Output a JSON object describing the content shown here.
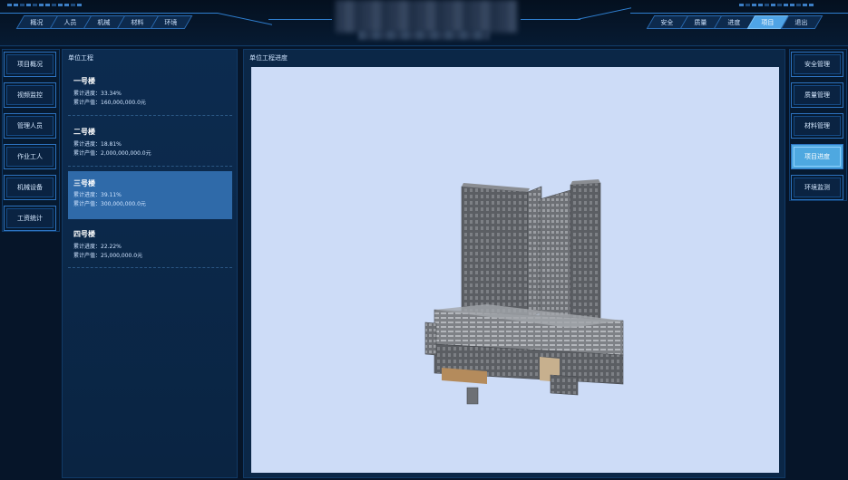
{
  "header": {
    "left_tabs": [
      {
        "label": "概况"
      },
      {
        "label": "人员"
      },
      {
        "label": "机械"
      },
      {
        "label": "材料"
      },
      {
        "label": "环境"
      }
    ],
    "right_tabs": [
      {
        "label": "安全"
      },
      {
        "label": "质量"
      },
      {
        "label": "进度"
      },
      {
        "label": "项目",
        "active": true
      },
      {
        "label": "退出"
      }
    ]
  },
  "left_menu": {
    "items": [
      {
        "label": "项目概况"
      },
      {
        "label": "视频监控"
      },
      {
        "label": "管理人员"
      },
      {
        "label": "作业工人"
      },
      {
        "label": "机械设备"
      },
      {
        "label": "工资统计"
      }
    ]
  },
  "right_menu": {
    "items": [
      {
        "label": "安全管理"
      },
      {
        "label": "质量管理"
      },
      {
        "label": "材料管理"
      },
      {
        "label": "项目进度",
        "active": true
      },
      {
        "label": "环境监测"
      }
    ]
  },
  "unit_panel": {
    "title": "单位工程",
    "items": [
      {
        "name": "一号楼",
        "progress": "累计进度：33.34%",
        "output": "累计产值：160,000,000.0元"
      },
      {
        "name": "二号楼",
        "progress": "累计进度：18.81%",
        "output": "累计产值：2,000,000,000.0元"
      },
      {
        "name": "三号楼",
        "progress": "累计进度：39.11%",
        "output": "累计产值：300,000,000.0元",
        "active": true
      },
      {
        "name": "四号楼",
        "progress": "累计进度：22.22%",
        "output": "累计产值：25,000,000.0元"
      }
    ]
  },
  "viewer_panel": {
    "title": "单位工程进度",
    "model": "building-3d-model"
  },
  "colors": {
    "background": "#061529",
    "panel": "#0b2747",
    "active_tab": "#4fa4e6",
    "active_item": "#2f6aa9",
    "viewport": "#cddcf7"
  }
}
